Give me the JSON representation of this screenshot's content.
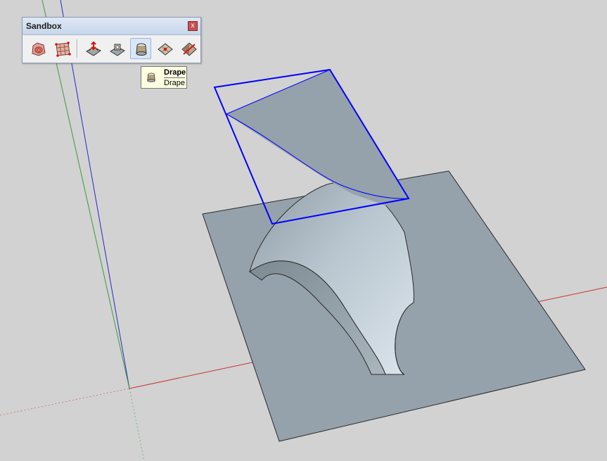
{
  "toolbar": {
    "title": "Sandbox",
    "close_glyph": "x",
    "buttons": [
      {
        "id": "from-contours",
        "icon": "from-contours-icon"
      },
      {
        "id": "from-scratch",
        "icon": "from-scratch-icon"
      },
      {
        "id": "smoove",
        "icon": "smoove-icon"
      },
      {
        "id": "stamp",
        "icon": "stamp-icon"
      },
      {
        "id": "drape",
        "icon": "drape-icon",
        "active": true
      },
      {
        "id": "add-detail",
        "icon": "add-detail-icon"
      },
      {
        "id": "flip-edge",
        "icon": "flip-edge-icon"
      }
    ]
  },
  "tooltip": {
    "title": "Drape",
    "description": "Drape"
  },
  "colors": {
    "background": "#d2d2d2",
    "terrain": "#95a2ab",
    "selection": "#0000ff",
    "red_axis": "#c83232",
    "green_axis": "#3c9a3c",
    "blue_axis": "#2828c8"
  }
}
